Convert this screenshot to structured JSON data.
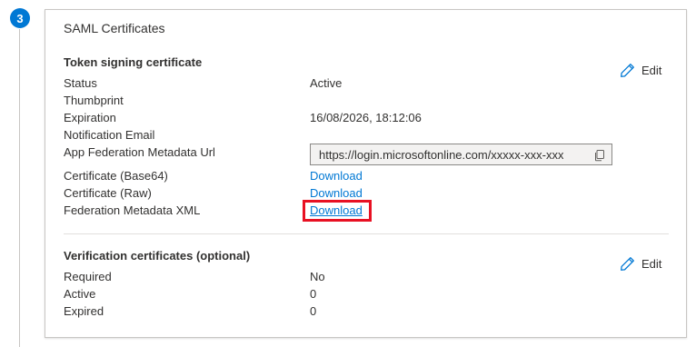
{
  "step": {
    "number": "3"
  },
  "card": {
    "title": "SAML Certificates"
  },
  "token_signing": {
    "heading": "Token signing certificate",
    "edit_label": "Edit",
    "rows": [
      {
        "label": "Status",
        "value": "Active"
      },
      {
        "label": "Thumbprint",
        "value": ""
      },
      {
        "label": "Expiration",
        "value": "16/08/2026, 18:12:06"
      },
      {
        "label": "Notification Email",
        "value": ""
      },
      {
        "label": "App Federation Metadata Url",
        "value": "https://login.microsoftonline.com/xxxxx-xxx-xxx"
      },
      {
        "label": "Certificate (Base64)",
        "value": "Download"
      },
      {
        "label": "Certificate (Raw)",
        "value": "Download"
      },
      {
        "label": "Federation Metadata XML",
        "value": "Download"
      }
    ]
  },
  "verification": {
    "heading": "Verification certificates (optional)",
    "edit_label": "Edit",
    "rows": [
      {
        "label": "Required",
        "value": "No"
      },
      {
        "label": "Active",
        "value": "0"
      },
      {
        "label": "Expired",
        "value": "0"
      }
    ]
  },
  "colors": {
    "accent": "#0078d4",
    "highlight": "#e81123"
  },
  "icons": {
    "edit": "pencil-icon",
    "copy": "copy-icon"
  }
}
